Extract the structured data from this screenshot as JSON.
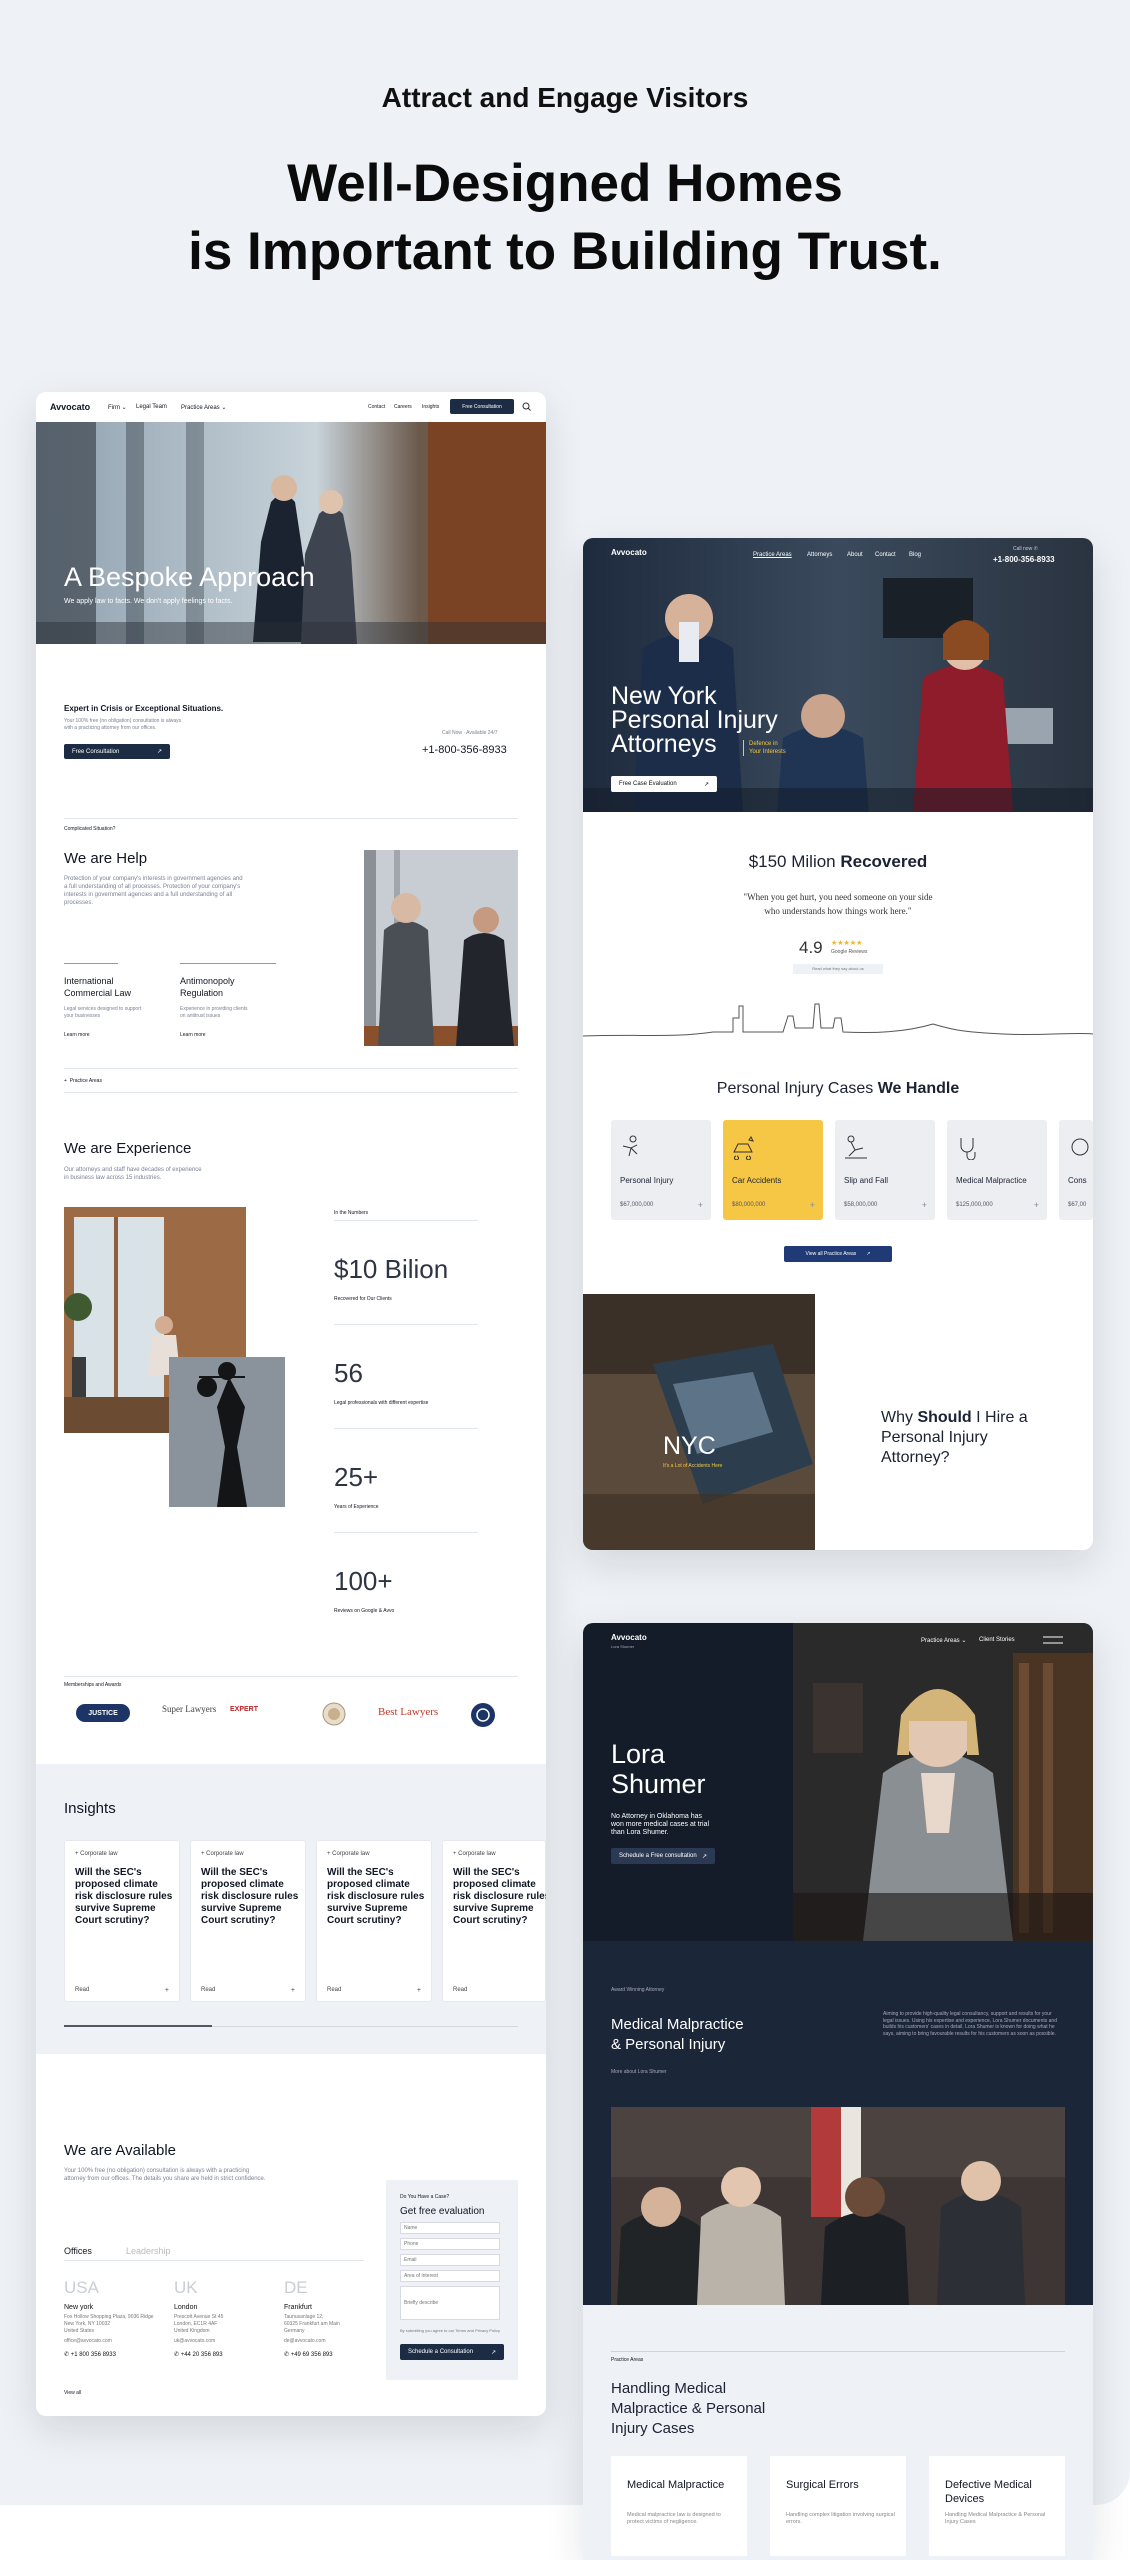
{
  "hero": {
    "eyebrow": "Attract and Engage Visitors",
    "headline_line1": "Well-Designed Homes",
    "headline_line2": "is Important to Building Trust."
  },
  "screen1": {
    "nav": {
      "logo": "Avvocato",
      "firm": "Firm ⌄",
      "legal_team": "Legal Team",
      "practice": "Practice Areas ⌄",
      "contact": "Contact",
      "careers": "Careers",
      "insights": "Insights",
      "cta": "Free Consultation"
    },
    "hero_title": "A Bespoke Approach",
    "hero_sub": "We apply law to facts. We don't apply feelings to facts.",
    "crisis_title": "Expert in Crisis or Exceptional Situations.",
    "crisis_text1": "Your 100% free (no obligation) consultation is always",
    "crisis_text2": "with a practicing attorney from our offices.",
    "crisis_btn": "Free Consultation",
    "call_label": "Call Now · Available 24/7",
    "phone": "+1-800-356-8933",
    "complicated": "Complicated Situation?",
    "help_title": "We are Help",
    "help_text1": "Protection of your company's interests in government agencies and",
    "help_text2": "a full understanding of all processes. Protection of your company's",
    "help_text3": "interests in government agencies and a full understanding of all",
    "help_text4": "processes.",
    "svc1_title1": "International",
    "svc1_title2": "Commercial Law",
    "svc1_desc1": "Legal services designed to support",
    "svc1_desc2": "your businesses",
    "svc1_link": "Learn more",
    "svc2_title1": "Antimonopoly",
    "svc2_title2": "Regulation",
    "svc2_desc1": "Experience in providing clients",
    "svc2_desc2": "on antitrust issues",
    "svc2_link": "Learn more",
    "practice_link": "Practice Areas",
    "exp_title": "We are Experience",
    "exp_text1": "Our attorneys and staff have decades of experience",
    "exp_text2": "in business law across 15 industries.",
    "numbers_label": "In the Numbers",
    "stats": [
      {
        "value": "$10 Bilion",
        "label": "Recovered for Our Clients"
      },
      {
        "value": "56",
        "label": "Legal professionals with different expertise"
      },
      {
        "value": "25+",
        "label": "Years of Experience"
      },
      {
        "value": "100+",
        "label": "Reviews on Google & Avvo"
      }
    ],
    "memberships": "Memberships and Awards",
    "logos": [
      "JUSTICE",
      "Super Lawyers",
      "EXPERT",
      "Best Lawyers"
    ],
    "insights_title": "Insights",
    "insight_tag": "Corporate law",
    "insight_title": "Will the SEC's proposed climate risk disclosure rules survive Supreme Court scrutiny?",
    "read": "Read",
    "avail_title": "We are Available",
    "avail_text1": "Your 100% free (no obligation) consultation is always with a practicing",
    "avail_text2": "attorney from our offices. The details you share are held in strict confidence.",
    "tab_offices": "Offices",
    "tab_leadership": "Leadership",
    "offices": [
      {
        "code": "USA",
        "city": "New york",
        "address": "Fox Hollow Shopping Plaza, 9036 Ridge\nNew York, NY 10032\nUnited States",
        "email": "office@avvocato.com",
        "phone": "+1 800 356 8933"
      },
      {
        "code": "UK",
        "city": "London",
        "address": "Prescott Avenue St 45\nLondon, EC1R 4AF\nUnited Kingdom",
        "email": "uk@avvocato.com",
        "phone": "+44 20 356 893"
      },
      {
        "code": "DE",
        "city": "Frankfurt",
        "address": "Taunusanlage 12,\n60325 Frankfurt am Main\nGermany",
        "email": "de@avvocato.com",
        "phone": "+49 69 356 893"
      }
    ],
    "view_all": "View all",
    "form_eyebrow": "Do You Have a Case?",
    "form_title": "Get free evaluation",
    "form_name": "Name",
    "form_phone": "Phone",
    "form_email": "Email",
    "form_area": "Area of interest",
    "form_desc": "Briefly describe",
    "form_consent": "By submitting you agree to our Terms and Privacy Policy",
    "form_btn": "Schedule a Consultation"
  },
  "screen2": {
    "nav": {
      "logo": "Avvocato",
      "practice": "Practice Areas",
      "attorneys": "Attorneys",
      "about": "About",
      "contact": "Contact",
      "blog": "Blog",
      "call": "Call now",
      "phone": "+1-800-356-8933"
    },
    "hero_title1": "New York",
    "hero_title2": "Personal Injury",
    "hero_title3": "Attorneys",
    "hero_tag1": "Defence in",
    "hero_tag2": "Your Interests",
    "hero_btn": "Free Case Evaluation",
    "recovered_amount": "$150 Milion ",
    "recovered_word": "Recovered",
    "quote1": "\"When you get hurt, you need someone on your side",
    "quote2": "who understands how things work here.\"",
    "rating": "4.9",
    "stars": "★★★★★",
    "reviews": "Google Reviews",
    "reviews_link": "Read what they say about us",
    "cases_title": "Personal Injury Cases ",
    "cases_bold": "We Handle",
    "cases": [
      {
        "name": "Personal Injury",
        "amount": "$67,000,000"
      },
      {
        "name": "Car Accidents",
        "amount": "$80,000,000"
      },
      {
        "name": "Slip and Fall",
        "amount": "$58,000,000"
      },
      {
        "name": "Medical Malpractice",
        "amount": "$125,000,000"
      },
      {
        "name": "Cons",
        "amount": "$67,00"
      }
    ],
    "view_all": "View all Practice Areas",
    "nyc": "NYC",
    "nyc_sub": "It's a Lot of Accidents Here",
    "why1": "Why ",
    "why_bold": "Should",
    "why2": " I Hire a",
    "why3": "Personal Injury",
    "why4": "Attorney?",
    "accent": "#f6c744",
    "navy": "#1b2c44"
  },
  "screen3": {
    "nav": {
      "logo": "Avvocato",
      "logo_sub": "Lora Shumer",
      "practice": "Practice Areas ⌄",
      "stories": "Client Stories"
    },
    "name1": "Lora",
    "name2": "Shumer",
    "desc1": "No Attorney in Oklahoma has",
    "desc2": "won more medical cases at trial",
    "desc3": "than Lora Shumer.",
    "btn": "Schedule a Free consultation",
    "award": "Award Winning Attorney",
    "mm_title1": "Medical Malpractice",
    "mm_title2": "& Personal Injury",
    "more_about": "More about Lora Shumer",
    "right_text": "Aiming to provide high-quality legal consultancy, support and results for your legal issues. Using his expertise and experience, Lora Shumer documents and builds his customers' cases in detail. Lora Shumer is known for doing what he says, aiming to bring favourable results for his customers as soon as possible.",
    "practice_label": "Practice Areas",
    "handling1": "Handling Medical",
    "handling2": "Malpractice & Personal",
    "handling3": "Injury Cases",
    "services": [
      {
        "name": "Medical Malpractice",
        "desc": "Medical malpractice law is designed to protect victims of negligence."
      },
      {
        "name": "Surgical Errors",
        "desc": "Handling complex litigation involving surgical errors."
      },
      {
        "name": "Defective Medical Devices",
        "desc": "Handling Medical Malpractice & Personal Injury Cases"
      }
    ]
  }
}
